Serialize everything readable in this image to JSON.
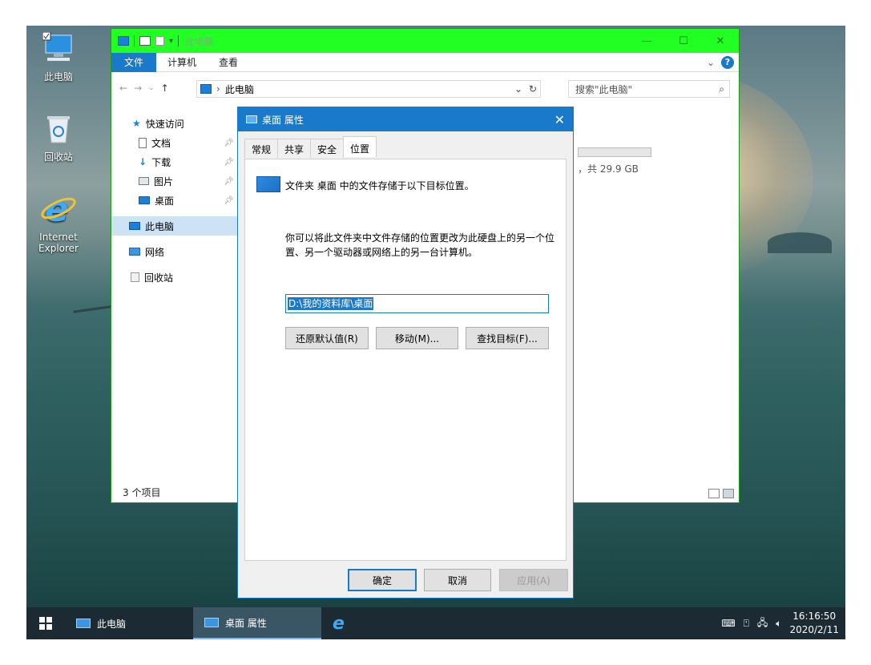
{
  "colors": {
    "titlebar_green": "#22ff22",
    "accent_blue": "#1979ca",
    "taskbar": "#1b2a33"
  },
  "desktop": {
    "icons": [
      {
        "label": "此电脑",
        "icon": "computer-icon"
      },
      {
        "label": "回收站",
        "icon": "recycle-bin-icon"
      },
      {
        "label": "Internet Explorer",
        "icon": "internet-explorer-icon"
      }
    ]
  },
  "explorer": {
    "title": "此电脑",
    "ribbon": {
      "file": "文件",
      "tabs": [
        "计算机",
        "查看"
      ]
    },
    "address": {
      "crumb": "此电脑"
    },
    "search": {
      "placeholder": "搜索\"此电脑\""
    },
    "nav": {
      "quick_access": "快速访问",
      "quick_items": [
        {
          "label": "文档",
          "icon": "document-icon"
        },
        {
          "label": "下载",
          "icon": "download-icon"
        },
        {
          "label": "图片",
          "icon": "picture-icon"
        },
        {
          "label": "桌面",
          "icon": "desktop-icon"
        }
      ],
      "this_pc": "此电脑",
      "network": "网络",
      "recycle": "回收站"
    },
    "capacity_text": "，共 29.9 GB",
    "status": "3 个项目"
  },
  "dialog": {
    "title": "桌面 属性",
    "tabs": [
      "常规",
      "共享",
      "安全",
      "位置"
    ],
    "active_tab": "位置",
    "heading": "文件夹 桌面 中的文件存储于以下目标位置。",
    "description": "你可以将此文件夹中文件存储的位置更改为此硬盘上的另一个位置、另一个驱动器或网络上的另一台计算机。",
    "path": "D:\\我的资料库\\桌面",
    "buttons": {
      "restore": "还原默认值(R)",
      "move": "移动(M)...",
      "find": "查找目标(F)..."
    },
    "footer": {
      "ok": "确定",
      "cancel": "取消",
      "apply": "应用(A)"
    }
  },
  "taskbar": {
    "tasks": [
      "此电脑",
      "桌面 属性"
    ],
    "time": "16:16:50",
    "date": "2020/2/11"
  }
}
